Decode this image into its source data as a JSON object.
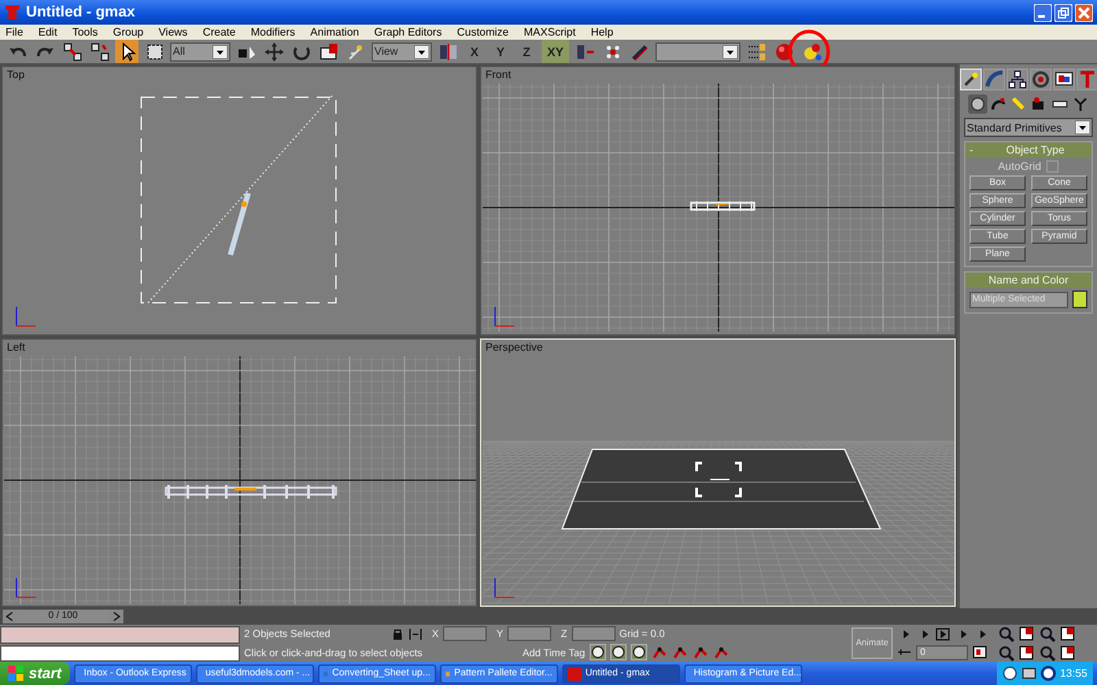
{
  "window": {
    "title": "Untitled - gmax"
  },
  "menu": [
    "File",
    "Edit",
    "Tools",
    "Group",
    "Views",
    "Create",
    "Modifiers",
    "Animation",
    "Graph Editors",
    "Customize",
    "MAXScript",
    "Help"
  ],
  "toolbar": [
    {
      "kind": "undo",
      "selected": false
    },
    {
      "kind": "redo",
      "selected": false
    },
    {
      "kind": "link",
      "selected": false
    },
    {
      "kind": "unlink",
      "selected": false
    },
    {
      "kind": "select",
      "selected": true
    },
    {
      "kind": "region",
      "selected": false
    },
    {
      "kind": "dropdown",
      "value": "All"
    },
    {
      "kind": "select-by-name",
      "selected": false
    },
    {
      "kind": "move",
      "selected": false
    },
    {
      "kind": "rotate",
      "selected": false
    },
    {
      "kind": "scale",
      "selected": false
    },
    {
      "kind": "pivot",
      "selected": false
    },
    {
      "kind": "dropdown",
      "value": "View"
    },
    {
      "kind": "mirror",
      "selected": false
    },
    {
      "kind": "axis",
      "label": "X",
      "selected": false
    },
    {
      "kind": "axis",
      "label": "Y",
      "selected": false
    },
    {
      "kind": "axis",
      "label": "Z",
      "selected": false
    },
    {
      "kind": "axis",
      "label": "XY",
      "selected": true
    },
    {
      "kind": "align",
      "selected": false
    },
    {
      "kind": "snap",
      "selected": false
    },
    {
      "kind": "spinner-snap",
      "selected": false
    },
    {
      "kind": "dropdown"
    },
    {
      "kind": "layers",
      "selected": false
    },
    {
      "kind": "render",
      "selected": false
    },
    {
      "kind": "material",
      "selected": false
    }
  ],
  "annotation": {
    "kind": "circle",
    "color": "#ff0000"
  },
  "viewports": [
    {
      "label": "Top",
      "kind": "top",
      "active": false
    },
    {
      "label": "Front",
      "kind": "front",
      "active": false
    },
    {
      "label": "Left",
      "kind": "left",
      "active": false
    },
    {
      "label": "Perspective",
      "kind": "perspective",
      "active": true
    }
  ],
  "command_panel": {
    "tabs": [
      {
        "kind": "create",
        "selected": true
      },
      {
        "kind": "modify",
        "selected": false
      },
      {
        "kind": "hierarchy",
        "selected": false
      },
      {
        "kind": "motion",
        "selected": false
      },
      {
        "kind": "display",
        "selected": false
      },
      {
        "kind": "utilities",
        "selected": false
      }
    ],
    "categories": [
      {
        "kind": "geometry",
        "selected": true
      },
      {
        "kind": "shapes",
        "selected": false
      },
      {
        "kind": "lights",
        "selected": false
      },
      {
        "kind": "cameras",
        "selected": false
      },
      {
        "kind": "helpers",
        "selected": false
      },
      {
        "kind": "systems",
        "selected": false
      }
    ],
    "type_dropdown": "Standard Primitives",
    "object_type": {
      "title": "Object Type",
      "collapse": "-",
      "autogrid": {
        "label": "AutoGrid",
        "checked": false,
        "disabled": true
      },
      "buttons": [
        "Box",
        "Cone",
        "Sphere",
        "GeoSphere",
        "Cylinder",
        "Torus",
        "Tube",
        "Pyramid",
        "Plane"
      ]
    },
    "name_and_color": {
      "title": "Name and Color",
      "name": "Multiple Selected",
      "color": "#c8dc3c"
    }
  },
  "time_slider": {
    "label": "0 / 100"
  },
  "status": {
    "selection": "2 Objects Selected",
    "prompt": "Click or click-and-drag to select objects",
    "coords": [
      "X",
      "Y",
      "Z"
    ],
    "grid": "Grid = 0.0",
    "time_tag": "Add Time Tag",
    "animate": "Animate",
    "frame": "0"
  },
  "taskbar": {
    "start": "start",
    "tasks": [
      {
        "label": "Inbox - Outlook Express",
        "selected": false
      },
      {
        "label": "useful3dmodels.com - ...",
        "selected": false
      },
      {
        "label": "Converting_Sheet up...",
        "selected": false
      },
      {
        "label": "Pattern Pallete Editor...",
        "selected": false
      },
      {
        "label": "Untitled - gmax",
        "selected": true
      },
      {
        "label": "Histogram & Picture Ed...",
        "selected": false
      }
    ],
    "clock": "13:55"
  }
}
